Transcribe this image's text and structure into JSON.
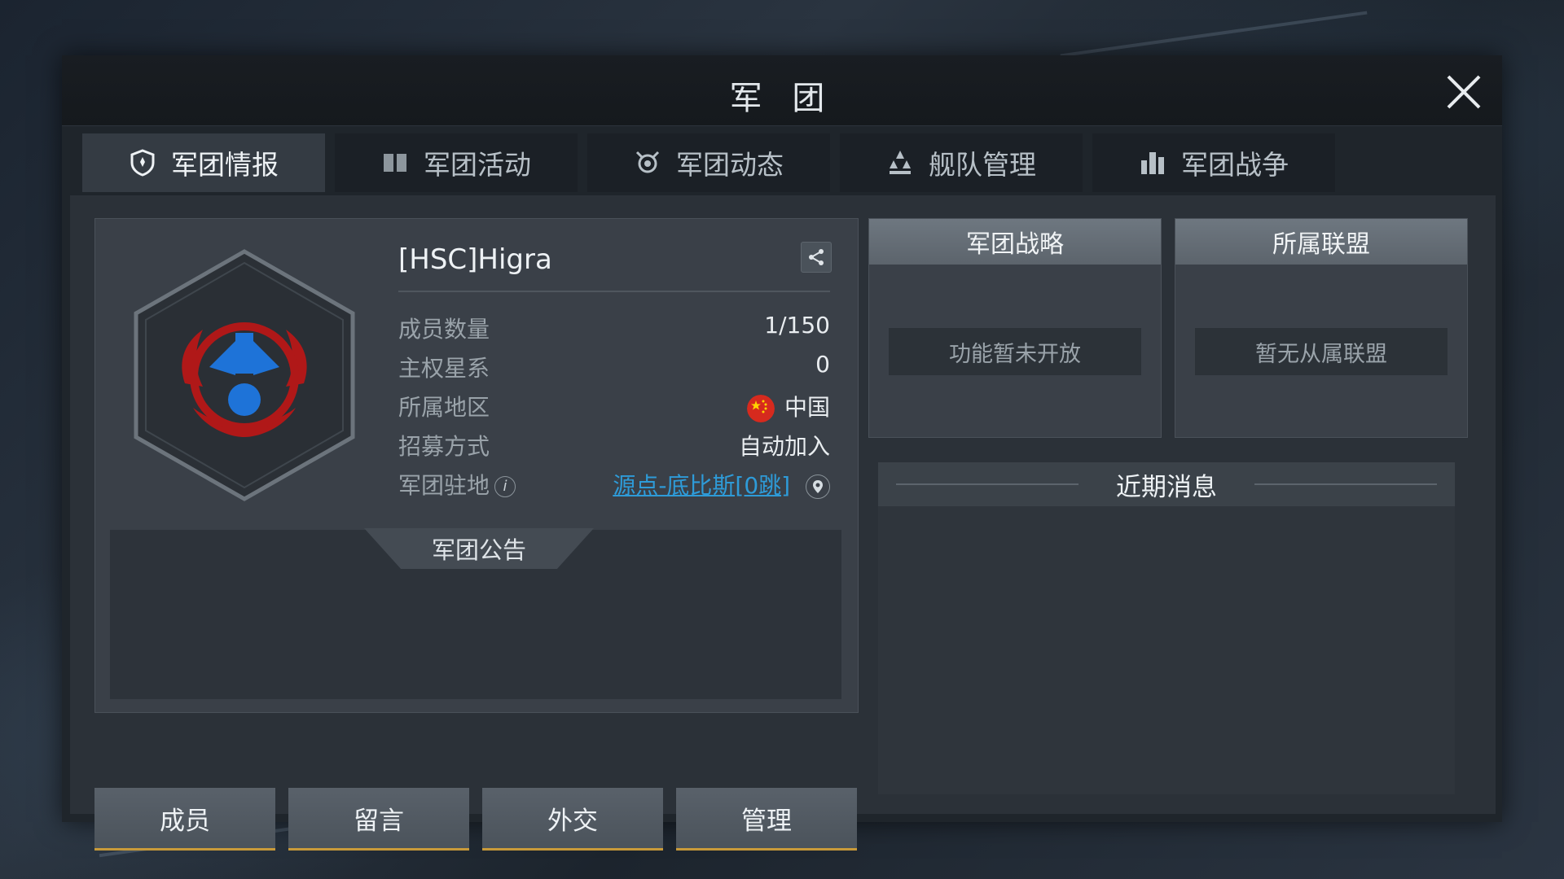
{
  "window": {
    "title": "军 团"
  },
  "tabs": [
    {
      "label": "军团情报",
      "icon": "shield-icon",
      "active": true
    },
    {
      "label": "军团活动",
      "icon": "book-icon",
      "active": false
    },
    {
      "label": "军团动态",
      "icon": "medal-icon",
      "active": false
    },
    {
      "label": "舰队管理",
      "icon": "fleet-icon",
      "active": false
    },
    {
      "label": "军团战争",
      "icon": "city-icon",
      "active": false
    }
  ],
  "guild": {
    "name": "[HSC]Higra",
    "fields": {
      "members": {
        "label": "成员数量",
        "value": "1/150"
      },
      "sovereignty": {
        "label": "主权星系",
        "value": "0"
      },
      "region": {
        "label": "所属地区",
        "value": "中国"
      },
      "recruit": {
        "label": "招募方式",
        "value": "自动加入"
      },
      "base": {
        "label": "军团驻地",
        "info": "i",
        "value": "源点-底比斯[0跳]"
      }
    },
    "notice_title": "军团公告"
  },
  "buttons": {
    "members": "成员",
    "message": "留言",
    "diplomacy": "外交",
    "manage": "管理"
  },
  "strategy": {
    "title": "军团战略",
    "note": "功能暂未开放"
  },
  "alliance": {
    "title": "所属联盟",
    "note": "暂无从属联盟"
  },
  "news": {
    "title": "近期消息"
  },
  "colors": {
    "link": "#2e9bd8",
    "button_accent": "#c89a3a",
    "emblem_red": "#b01818",
    "emblem_blue": "#1e73d8"
  }
}
